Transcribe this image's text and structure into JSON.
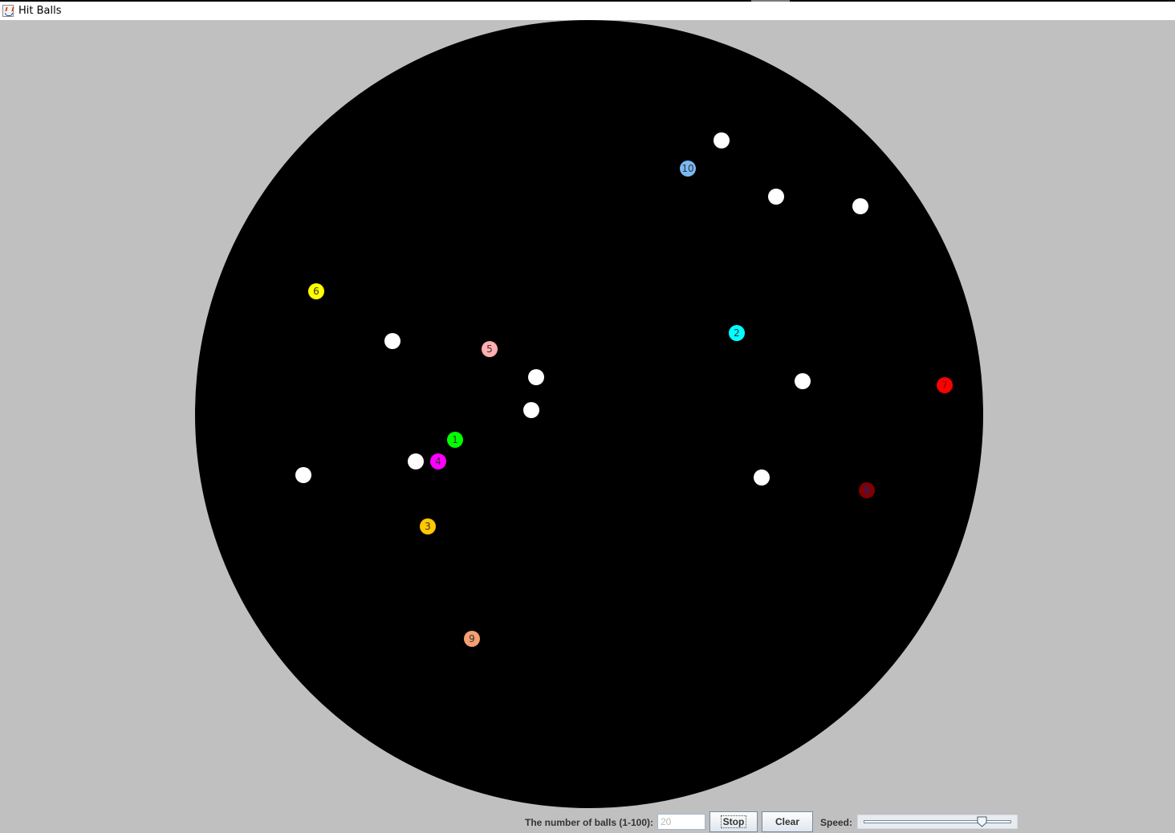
{
  "window": {
    "title": "Hit Balls",
    "icon": "java-cup-icon"
  },
  "arena": {
    "background": "#c0c0c0",
    "circle_color": "#000000",
    "numbered_balls": [
      {
        "label": "1",
        "color": "#00ff00"
      },
      {
        "label": "2",
        "color": "#00ffff"
      },
      {
        "label": "3",
        "color": "#ffc800"
      },
      {
        "label": "4",
        "color": "#ff00ff"
      },
      {
        "label": "5",
        "color": "#ffafaf"
      },
      {
        "label": "6",
        "color": "#ffff00"
      },
      {
        "label": "7",
        "color": "#ff0000"
      },
      {
        "label": "8",
        "color": "#800000"
      },
      {
        "label": "9",
        "color": "#f4a070"
      },
      {
        "label": "10",
        "color": "#7ab8f5"
      }
    ],
    "white_ball_color": "#ffffff",
    "white_ball_count": 10
  },
  "controls": {
    "balls_label": "The number of balls (1-100):",
    "balls_value": "20",
    "stop_label": "Stop",
    "clear_label": "Clear",
    "speed_label": "Speed:",
    "speed_fraction": 0.8
  }
}
